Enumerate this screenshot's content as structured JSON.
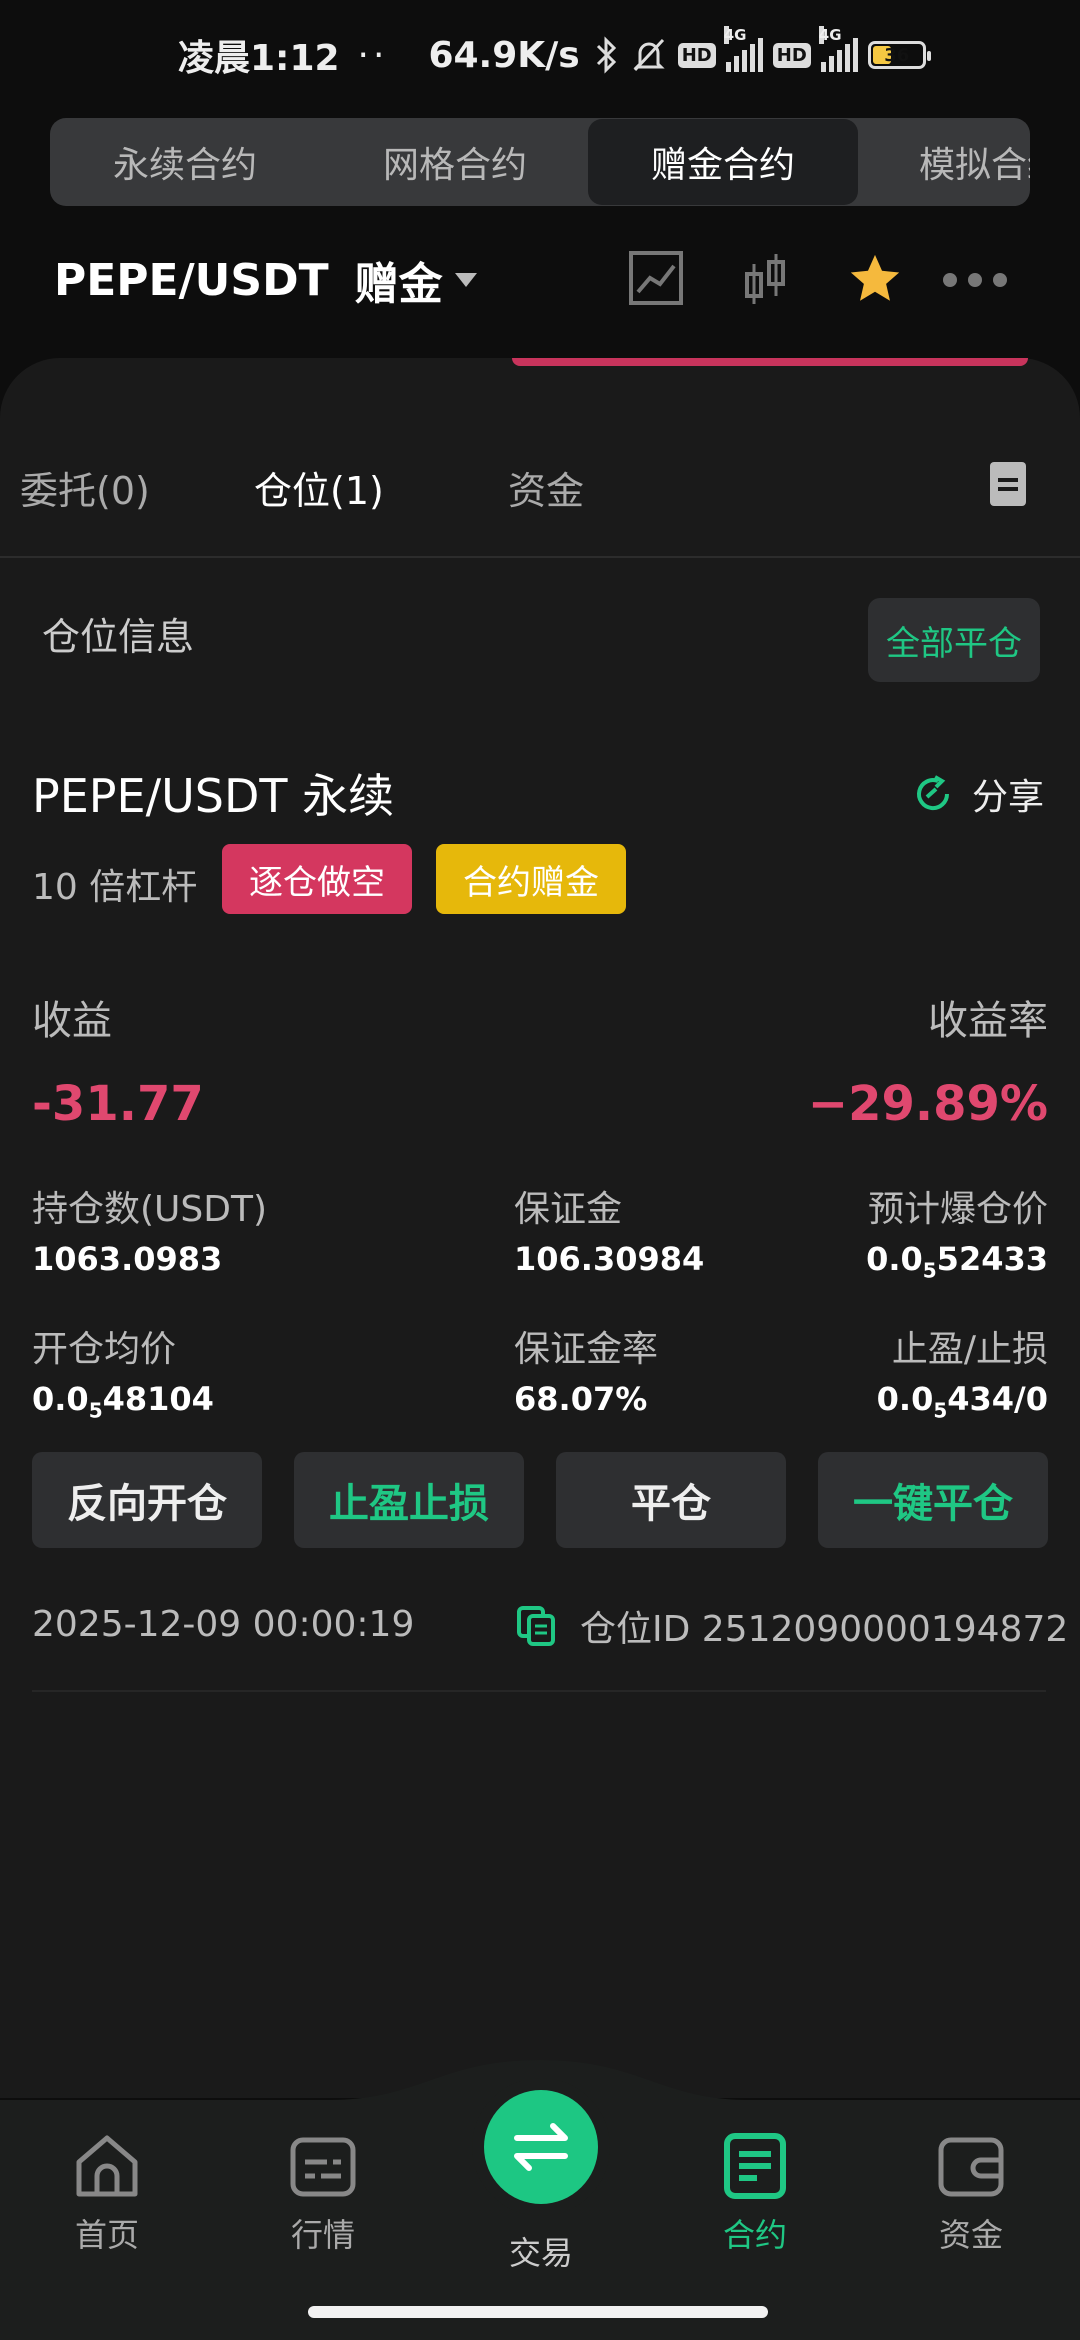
{
  "status": {
    "time": "凌晨1:12",
    "dots": "··",
    "speed": "64.9K/s",
    "hd": "HD",
    "net": "4G",
    "battery": "36"
  },
  "contract_tabs": [
    "永续合约",
    "网格合约",
    "赠金合约",
    "模拟合约"
  ],
  "header": {
    "pair": "PEPE/USDT",
    "bonus": "赠金"
  },
  "panel_tabs": {
    "orders": "委托(0)",
    "positions": "仓位(1)",
    "funds": "资金"
  },
  "section": {
    "title": "仓位信息",
    "close_all": "全部平仓"
  },
  "position": {
    "title": "PEPE/USDT 永续",
    "share": "分享",
    "leverage": "10 倍杠杆",
    "tag_short": "逐仓做空",
    "tag_bonus": "合约赠金",
    "pnl_label": "收益",
    "pnl_value": "-31.77",
    "roe_label": "收益率",
    "roe_value": "−29.89%",
    "size_label": "持仓数(USDT)",
    "size_value": "1063.0983",
    "margin_label": "保证金",
    "margin_value": "106.30984",
    "liq_label": "预计爆仓价",
    "liq_pre": "0.0",
    "liq_sub": "5",
    "liq_post": "52433",
    "entry_label": "开仓均价",
    "entry_pre": "0.0",
    "entry_sub": "5",
    "entry_post": "48104",
    "mratio_label": "保证金率",
    "mratio_value": "68.07%",
    "tpsl_label": "止盈/止损",
    "tpsl_pre": "0.0",
    "tpsl_sub": "5",
    "tpsl_post": "434/0",
    "btn_reverse": "反向开仓",
    "btn_tpsl": "止盈止损",
    "btn_close": "平仓",
    "btn_oneclick": "一键平仓",
    "open_time": "2025-12-09 00:00:19",
    "position_id": "仓位ID 2512090000194872"
  },
  "nav": {
    "home": "首页",
    "market": "行情",
    "trade": "交易",
    "contract": "合约",
    "assets": "资金"
  },
  "colors": {
    "accent_green": "#1fc784",
    "loss_red": "#e0486f",
    "bonus_yellow": "#e6b80b"
  }
}
